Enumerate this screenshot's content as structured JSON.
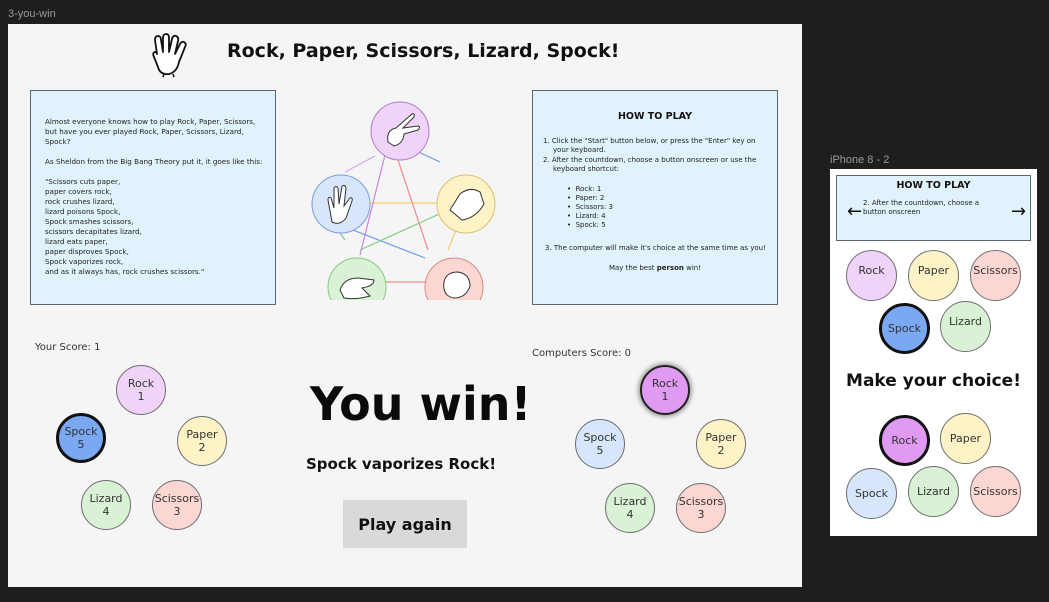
{
  "frames": {
    "main_label": "3-you-win",
    "phone_label": "iPhone 8 - 2"
  },
  "header": {
    "title": "Rock, Paper, Scissors, Lizard, Spock!",
    "logo_icon": "vulcan-salute-hand-icon"
  },
  "intro": {
    "text": "Almost everyone knows how to play Rock, Paper, Scissors,\nbut have you ever played Rock, Paper, Scissors, Lizard, Spock?\n\nAs Sheldon from the Big Bang Theory put it, it goes like this:\n\n\"Scissors cuts paper,\npaper covers rock,\nrock crushes lizard,\nlizard poisons Spock,\nSpock smashes scissors,\nscissors decapitates lizard,\nlizard eats paper,\npaper disproves Spock,\nSpock vaporizes rock,\nand as it always has, rock crushes scissors.\""
  },
  "diagram": {
    "nodes": [
      "rock-hand-icon",
      "paper-hand-icon",
      "scissors-hand-icon",
      "lizard-hand-icon",
      "spock-hand-icon"
    ]
  },
  "howto": {
    "title": "HOW TO PLAY",
    "step1a": "1.  Click the \"Start\" button below, or press the \"Enter\" key on",
    "step1b": "your keyboard.",
    "step2a": "2.  After the countdown, choose a button onscreen or use the",
    "step2b": "keyboard shortcut:",
    "shortcuts": [
      "Rock: 1",
      "Paper: 2",
      "Scissors: 3",
      "Lizard: 4",
      "Spock: 5"
    ],
    "step3": "3.  The computer will make it's choice at the same time as you!",
    "closing_pre": "May the best ",
    "closing_bold": "person",
    "closing_post": " win!"
  },
  "player": {
    "score_label": "Your Score: 1",
    "buttons": [
      {
        "name": "Rock",
        "key": "1"
      },
      {
        "name": "Paper",
        "key": "2"
      },
      {
        "name": "Scissors",
        "key": "3"
      },
      {
        "name": "Lizard",
        "key": "4"
      },
      {
        "name": "Spock",
        "key": "5"
      }
    ],
    "selected": "Spock"
  },
  "computer": {
    "score_label": "Computers Score: 0",
    "buttons": [
      {
        "name": "Rock",
        "key": "1"
      },
      {
        "name": "Paper",
        "key": "2"
      },
      {
        "name": "Scissors",
        "key": "3"
      },
      {
        "name": "Lizard",
        "key": "4"
      },
      {
        "name": "Spock",
        "key": "5"
      }
    ],
    "selected": "Rock"
  },
  "result": {
    "headline": "You win!",
    "detail": "Spock vaporizes Rock!",
    "play_again": "Play again"
  },
  "phone": {
    "howto_title": "HOW TO PLAY",
    "howto_text": "2. After the countdown, choose a button onscreen",
    "prev_arrow": "←",
    "next_arrow": "→",
    "top_buttons": [
      "Rock",
      "Paper",
      "Scissors",
      "Spock",
      "Lizard"
    ],
    "top_selected": "Spock",
    "prompt": "Make your choice!",
    "bottom_buttons": [
      "Rock",
      "Paper",
      "Spock",
      "Lizard",
      "Scissors"
    ],
    "bottom_selected": "Rock"
  },
  "colors": {
    "rock": "#f0d3f8",
    "paper": "#fdf3c7",
    "scissors": "#fcd6d3",
    "lizard": "#d9f1d5",
    "spock": "#d7e6fb",
    "spock_selected": "#7aa8f3",
    "rock_selected": "#e09af1",
    "panel": "#e0f2fb"
  }
}
